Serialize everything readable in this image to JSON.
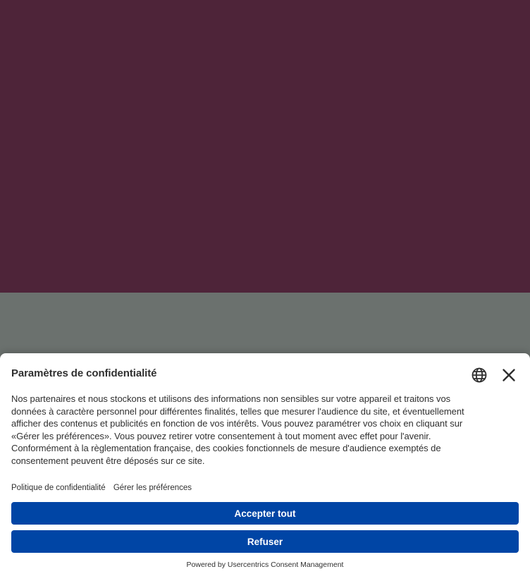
{
  "banner": {
    "title": "Paramètres de confidentialité",
    "description": "Nos partenaires et nous stockons et utilisons des informations non sensibles sur votre appareil et traitons vos\ndonnées à caractère personnel pour différentes finalités, telles que mesurer l'audience du site, et éventuellement\nafficher des contenus et publicités en fonction de vos intérêts. Vous pouvez paramétrer vos choix en cliquant sur\n«Gérer les préférences». Vous pouvez retirer votre consentement à tout moment avec effet pour l'avenir.\nConformément à la règlementation française, des cookies fonctionnels de mesure d'audience exemptés de\nconsentement peuvent être déposés sur ce site.",
    "links": {
      "privacy_policy": "Politique de confidentialité",
      "manage_preferences": "Gérer les préférences"
    },
    "buttons": {
      "accept_all": "Accepter tout",
      "refuse": "Refuser"
    },
    "powered_by": "Powered by Usercentrics Consent Management",
    "icons": {
      "language": "globe-icon",
      "close": "close-icon"
    }
  },
  "colors": {
    "background_top": "#4e2439",
    "background_bottom": "#6b716e",
    "button": "#0045a5",
    "text": "#303030"
  }
}
